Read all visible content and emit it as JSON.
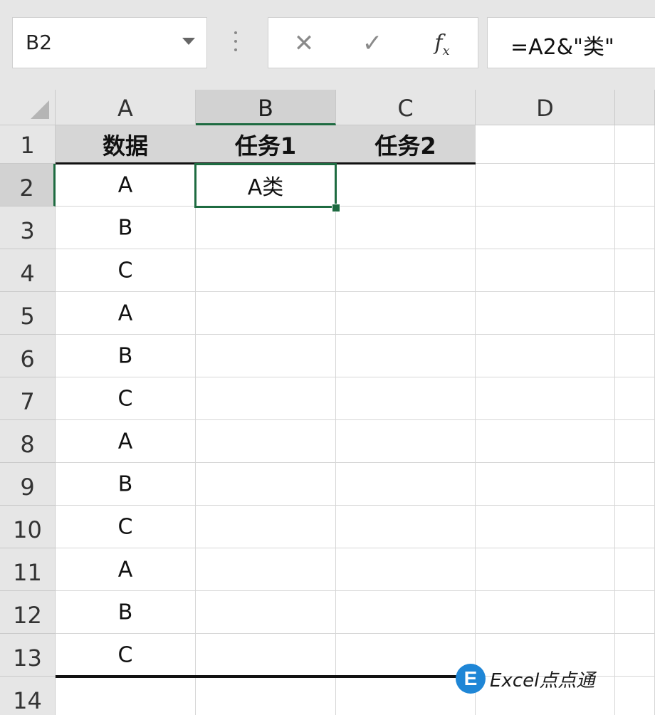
{
  "name_box": {
    "value": "B2"
  },
  "formula_bar": {
    "cancel_icon": "close-icon",
    "enter_icon": "checkmark-icon",
    "fx_label": "f",
    "fx_sub": "x",
    "formula": "=A2&\"类\""
  },
  "columns": [
    "A",
    "B",
    "C",
    "D"
  ],
  "rows": [
    "1",
    "2",
    "3",
    "4",
    "5",
    "6",
    "7",
    "8",
    "9",
    "10",
    "11",
    "12",
    "13",
    "14"
  ],
  "cells": {
    "A": [
      "数据",
      "A",
      "B",
      "C",
      "A",
      "B",
      "C",
      "A",
      "B",
      "C",
      "A",
      "B",
      "C",
      ""
    ],
    "B": [
      "任务1",
      "A类",
      "",
      "",
      "",
      "",
      "",
      "",
      "",
      "",
      "",
      "",
      "",
      ""
    ],
    "C": [
      "任务2",
      "",
      "",
      "",
      "",
      "",
      "",
      "",
      "",
      "",
      "",
      "",
      "",
      ""
    ],
    "D": [
      "",
      "",
      "",
      "",
      "",
      "",
      "",
      "",
      "",
      "",
      "",
      "",
      "",
      ""
    ]
  },
  "selected_cell": "B2",
  "colors": {
    "accent": "#1e6b41",
    "watermark_logo": "#1f86d6"
  },
  "watermark": {
    "logo_letter": "E",
    "text": "Excel点点通"
  }
}
